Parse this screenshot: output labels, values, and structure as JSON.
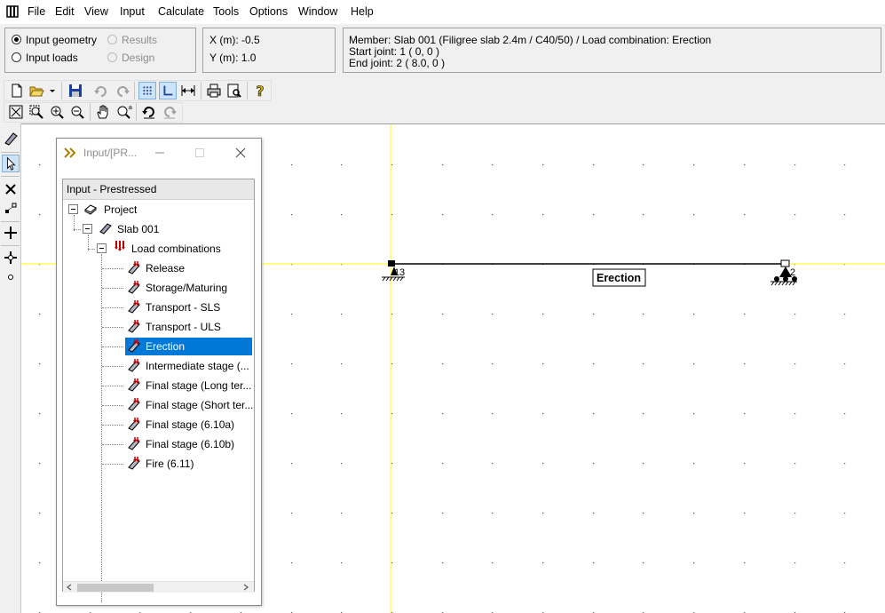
{
  "menu": [
    "File",
    "Edit",
    "View",
    "Input",
    "Calculate",
    "Tools",
    "Options",
    "Window",
    "Help"
  ],
  "mode": {
    "input_geometry": "Input geometry",
    "input_loads": "Input loads",
    "results": "Results",
    "design": "Design"
  },
  "coords": {
    "x": "X (m): -0.5",
    "y": "Y (m): 1.0"
  },
  "info": {
    "line1": "Member: Slab 001  (Filigree slab 2.4m / C40/50) / Load combination: Erection",
    "line2": "Start joint: 1  ( 0, 0 )",
    "line3": "End joint: 2  ( 8.0, 0 )"
  },
  "tree_window": {
    "title": "Input/[PR...",
    "header": "Input - Prestressed",
    "project": "Project",
    "member": "Slab 001",
    "group": "Load combinations",
    "items": [
      "Release",
      "Storage/Maturing",
      "Transport - SLS",
      "Transport - ULS",
      "Erection",
      "Intermediate stage (...",
      "Final stage (Long ter...",
      "Final stage (Short ter...",
      "Final stage (6.10a)",
      "Final stage (6.10b)",
      "Fire (6.11)"
    ],
    "selected_index": 4
  },
  "canvas": {
    "beam_label": "Erection",
    "joint_left": "1",
    "joint_left_extra": "3",
    "joint_right": "2",
    "crosshair_color": "#ffff00",
    "selection_color": "#0078d7"
  }
}
